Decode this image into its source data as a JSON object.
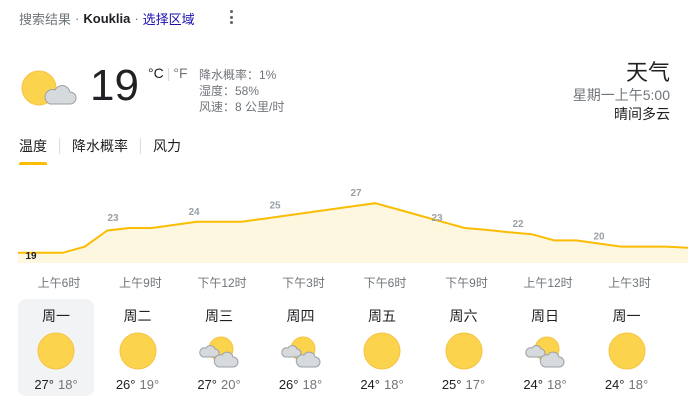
{
  "header": {
    "prefix": "搜索结果",
    "dot1": "·",
    "location": "Kouklia",
    "dot2": "·",
    "region_link": "选择区域",
    "more_icon": "more-vert-icon"
  },
  "current": {
    "icon": "partly-cloudy-icon",
    "temperature": "19",
    "unit_c": "°C",
    "unit_sep": "|",
    "unit_f": "°F",
    "precip": "降水概率：1%",
    "humidity": "湿度：58%",
    "wind": "风速：8 公里/时"
  },
  "summary": {
    "title": "天气",
    "time": "星期一上午5:00",
    "condition": "晴间多云"
  },
  "tabs": [
    {
      "label": "温度",
      "active": true
    },
    {
      "label": "降水概率",
      "active": false
    },
    {
      "label": "风力",
      "active": false
    }
  ],
  "colors": {
    "accent": "#fbbc04",
    "fill": "#fef7e0",
    "text": "#202124",
    "secondary": "#70757a"
  },
  "chart_data": {
    "type": "area",
    "x": [
      "上午6时",
      "上午9时",
      "下午12时",
      "下午3时",
      "下午6时",
      "下午9时",
      "上午12时",
      "上午3时"
    ],
    "series": [
      {
        "values": [
          19,
          23,
          24,
          25,
          27,
          23,
          22,
          20
        ]
      }
    ],
    "data_labels": [
      "19",
      "23",
      "24",
      "25",
      "27",
      "23",
      "22",
      "20"
    ],
    "curve_values": [
      19,
      19,
      19,
      20,
      22.6,
      23,
      23,
      23.5,
      24,
      24,
      24,
      24.5,
      25,
      25.5,
      26,
      26.5,
      27,
      26,
      25,
      24,
      23,
      22.7,
      22.3,
      22,
      21,
      21,
      20.5,
      20,
      20,
      20,
      19.8
    ],
    "grid": false
  },
  "days": [
    {
      "name": "周一",
      "icon": "sunny-icon",
      "hi": "27°",
      "lo": "18°",
      "selected": true
    },
    {
      "name": "周二",
      "icon": "sunny-icon",
      "hi": "26°",
      "lo": "19°",
      "selected": false
    },
    {
      "name": "周三",
      "icon": "partly-cloudy-icon",
      "hi": "27°",
      "lo": "20°",
      "selected": false
    },
    {
      "name": "周四",
      "icon": "partly-cloudy-icon",
      "hi": "26°",
      "lo": "18°",
      "selected": false
    },
    {
      "name": "周五",
      "icon": "sunny-icon",
      "hi": "24°",
      "lo": "18°",
      "selected": false
    },
    {
      "name": "周六",
      "icon": "sunny-icon",
      "hi": "25°",
      "lo": "17°",
      "selected": false
    },
    {
      "name": "周日",
      "icon": "partly-cloudy-icon",
      "hi": "24°",
      "lo": "18°",
      "selected": false
    },
    {
      "name": "周一",
      "icon": "sunny-icon",
      "hi": "24°",
      "lo": "18°",
      "selected": false
    }
  ]
}
